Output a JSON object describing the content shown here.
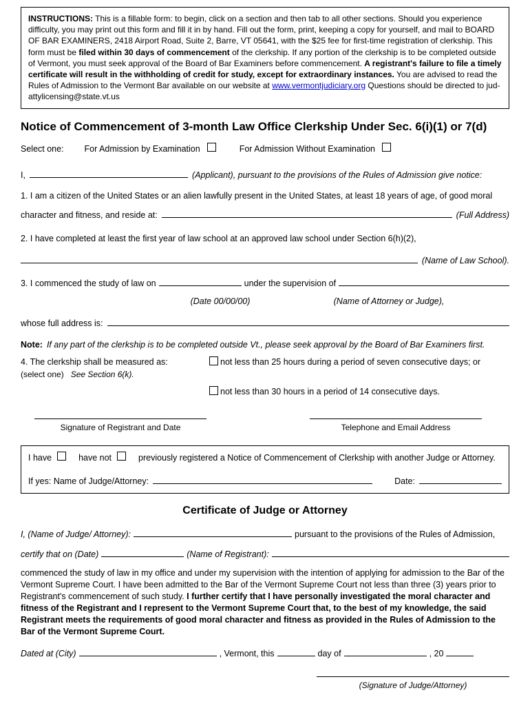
{
  "instructions": {
    "label": "INSTRUCTIONS:",
    "p1a": "  This is a fillable form:  to begin, click on a section and then tab to all other sections.  Should you experience difficulty, you may print out this form and fill it in by hand.  Fill out the form, print, keeping a copy for yourself, and mail to BOARD OF BAR EXAMINERS, 2418 Airport Road, Suite 2, Barre, VT  05641, with the $25 fee for first-time registration of clerkship.  This form must be ",
    "p1b_bold": "filed within 30 days of commencement",
    "p1c": " of the clerkship.  If any portion of the clerkship is to be completed outside of Vermont, you must seek approval of the Board of Bar Examiners before commencement.  ",
    "p1d_bold": "A registrant's failure to file a timely certificate will result in the withholding of credit for study, except for extraordinary instances.",
    "p1e": "  You are advised to read the Rules of Admission to the Vermont Bar available on our website at ",
    "link": "www.vermontjudiciary.org",
    "p1f": "  Questions should be directed to jud-attylicensing@state.vt.us"
  },
  "title": "Notice of Commencement of 3-month Law Office Clerkship Under Sec. 6(i)(1) or 7(d)",
  "select": {
    "label": "Select one:",
    "opt1": "For Admission by Examination",
    "opt2": "For Admission Without Examination"
  },
  "applicant": {
    "i": "I,",
    "suffix": "(Applicant), pursuant to the provisions of the Rules of Admission give notice:"
  },
  "item1": {
    "text": "1.  I am a citizen of the United States or an alien lawfully present in the United States, at least 18 years of age, of good moral",
    "cont": "character and fitness, and reside at:",
    "hint": "(Full Address)"
  },
  "item2": {
    "text": "2.  I have completed at least the first year of law school at an approved law school under Section 6(h)(2),",
    "hint": "(Name of Law School)."
  },
  "item3": {
    "a": "3.  I commenced the study of law on",
    "date_hint": "(Date 00/00/00)",
    "b": "under the supervision of",
    "name_hint": "(Name of Attorney or Judge),",
    "whose": "whose full address is:"
  },
  "note": {
    "label": "Note:",
    "text": "If any part of the clerkship is to be completed outside Vt., please seek approval by the Board of Bar Examiners first."
  },
  "item4": {
    "label": "4.  The clerkship shall be measured as:",
    "sub": "(select one)   See Section 6(k).",
    "opt1": "not less than 25 hours during a period of seven consecutive days; or",
    "opt2": "not less than 30 hours in a period of 14 consecutive days."
  },
  "sig": {
    "left": "Signature of Registrant and Date",
    "right": "Telephone and Email Address"
  },
  "prev": {
    "a": "I have",
    "b": "have not",
    "c": "previously registered a Notice of Commencement of Clerkship with another Judge or Attorney.",
    "if_yes": "If yes:  Name of Judge/Attorney:",
    "date": "Date:"
  },
  "cert": {
    "title": "Certificate of Judge or Attorney",
    "line1_a": "I, (Name of Judge/ Attorney):",
    "line1_b": "pursuant to the provisions of the Rules of Admission,",
    "line2_a": "certify that on (Date)",
    "line2_b": "(Name of Registrant):",
    "body_a": "commenced the study of law in my office and under my supervision with the intention of applying for admission to the Bar of the Vermont Supreme Court.  I have been admitted to the Bar of the Vermont Supreme Court not less than three (3) years prior to Registrant's commencement of such study.  ",
    "body_b_bold": "I further certify that I have personally investigated the moral character and fitness of the Registrant and I represent to the Vermont Supreme Court that, to the best of my knowledge, the said Registrant meets the requirements of good moral character and fitness as provided in the Rules of Admission to the Bar of the Vermont Supreme Court.",
    "dated_a": "Dated at (City)",
    "dated_b": ", Vermont, this",
    "dated_c": "day of",
    "dated_d": ", 20",
    "sig": "(Signature of Judge/Attorney)"
  }
}
